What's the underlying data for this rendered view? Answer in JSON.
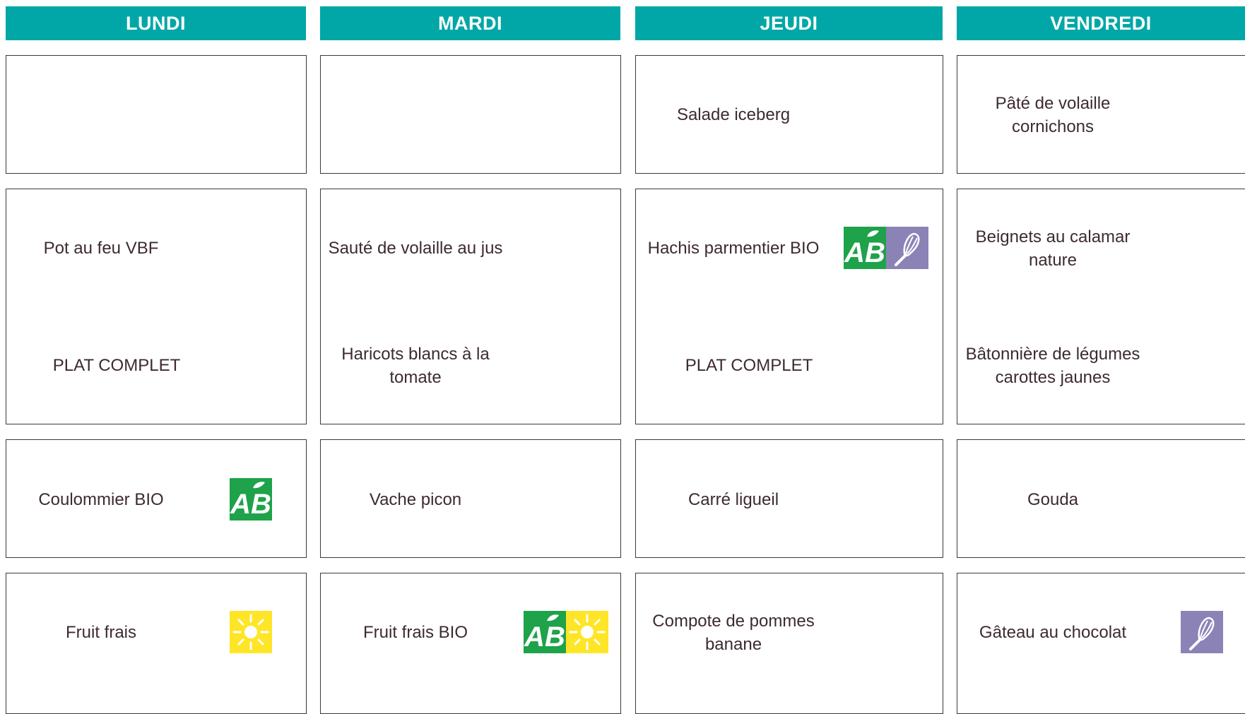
{
  "days": [
    "LUNDI",
    "MARDI",
    "JEUDI",
    "VENDREDI"
  ],
  "menu": {
    "jeudi_entree": "Salade iceberg",
    "vendredi_entree": [
      "Pâté de volaille",
      "cornichons"
    ],
    "lundi_plat": "Pot au feu VBF",
    "lundi_accomp": "PLAT COMPLET",
    "mardi_plat": "Sauté de volaille au jus",
    "mardi_accomp": [
      "Haricots blancs à la",
      "tomate"
    ],
    "jeudi_plat": "Hachis parmentier BIO",
    "jeudi_accomp": "PLAT COMPLET",
    "vendredi_plat": [
      "Beignets au calamar",
      "nature"
    ],
    "vendredi_accomp": [
      "Bâtonnière de légumes",
      "carottes jaunes"
    ],
    "lundi_fromage": "Coulommier BIO",
    "mardi_fromage": "Vache picon",
    "jeudi_fromage": "Carré ligueil",
    "vendredi_fromage": "Gouda",
    "lundi_dessert": "Fruit frais",
    "mardi_dessert": "Fruit frais BIO",
    "jeudi_dessert": [
      "Compote de pommes",
      "banane"
    ],
    "vendredi_dessert": "Gâteau au chocolat"
  },
  "colors": {
    "header": "#00a7a6",
    "bio": "#1ea24a",
    "saison": "#ffe527",
    "fait_maison": "#8b83b6"
  },
  "icons": {
    "bio": "ab-bio-logo",
    "saison": "sun-icon",
    "fait_maison": "whisk-icon"
  }
}
